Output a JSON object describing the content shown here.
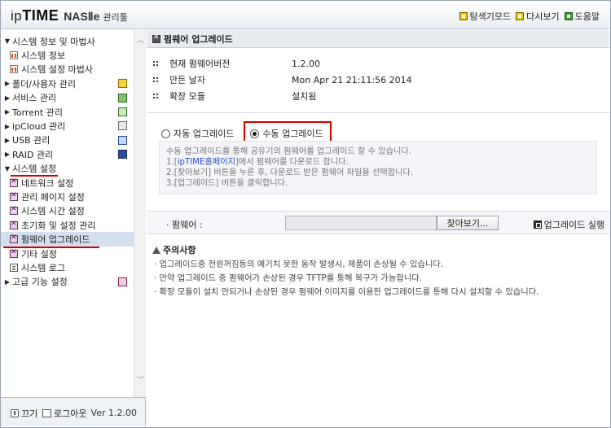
{
  "header": {
    "brand_a": "ip",
    "brand_b": "TIME",
    "product": "NASⅡe",
    "suffix": "관리툴",
    "links": [
      {
        "label": "탐색기모드",
        "icon": "explorer-icon"
      },
      {
        "label": "다시보기",
        "icon": "refresh-icon"
      },
      {
        "label": "도움말",
        "icon": "help-icon"
      }
    ]
  },
  "sidebar": {
    "groups": [
      {
        "label": "시스템 정보 및 마법사",
        "expanded": true,
        "children": [
          {
            "label": "시스템 정보"
          },
          {
            "label": "시스템 설정 마법사"
          }
        ]
      },
      {
        "label": "폴더/사용자 관리"
      },
      {
        "label": "서비스 관리"
      },
      {
        "label": "Torrent 관리"
      },
      {
        "label": "ipCloud 관리"
      },
      {
        "label": "USB 관리"
      },
      {
        "label": "RAID 관리"
      },
      {
        "label": "시스템 설정",
        "expanded": true,
        "children": [
          {
            "label": "네트워크 설정"
          },
          {
            "label": "관리 페이지 설정"
          },
          {
            "label": "시스템 시간 설정"
          },
          {
            "label": "초기화 및 설정 관리"
          },
          {
            "label": "펌웨어 업그레이드",
            "selected": true
          },
          {
            "label": "기타 설정"
          },
          {
            "label": "시스템 로그"
          }
        ]
      },
      {
        "label": "고급 기능 설정"
      }
    ],
    "footer": {
      "power_label": "끄기",
      "logout_label": "로그아웃",
      "version": "Ver 1.2.00"
    }
  },
  "main": {
    "title": "펌웨어 업그레이드",
    "info": [
      {
        "key": "현재 펌웨어버전",
        "value": "1.2.00"
      },
      {
        "key": "만든 날자",
        "value": "Mon Apr 21 21:11:56 2014"
      },
      {
        "key": "확장 모듈",
        "value": "설치됨"
      }
    ],
    "radios": {
      "auto_label": "자동 업그레이드",
      "manual_label": "수동 업그레이드",
      "selected": "manual"
    },
    "help": {
      "line1": "수동 업그레이드를 통해 공유기의 펌웨어를 업그레이드 할 수 있습니다.",
      "line2_pre": "1.[",
      "line2_link": "ipTIME홈페이지",
      "line2_post": "]에서 펌웨어를 다운로드 합니다.",
      "line3": "2.[찾아보기] 버튼을 누른 후, 다운로드 받은 펌웨어 파일을 선택합니다.",
      "line4": "3.[업그레이드] 버튼을 클릭합니다."
    },
    "firmware": {
      "label": "· 펌웨어 :",
      "value": "",
      "browse_label": "찾아보기...",
      "run_label": "업그레이드 실행"
    },
    "notice": {
      "title": "주의사항",
      "lines": [
        "· 업그레이드중 전원꺼짐등의 예기치 못한 동작 발생시, 제품이 손상될 수 있습니다.",
        "· 만약 업그레이드 중 펌웨어가 손상된 경우 TFTP를 통해 복구가 가능합니다.",
        "· 확장 모듈이 설치 안되거나 손상된 경우 펌웨어 이미지를 이용한 업그레이드를 통해 다시 설치할 수 있습니다."
      ]
    }
  }
}
